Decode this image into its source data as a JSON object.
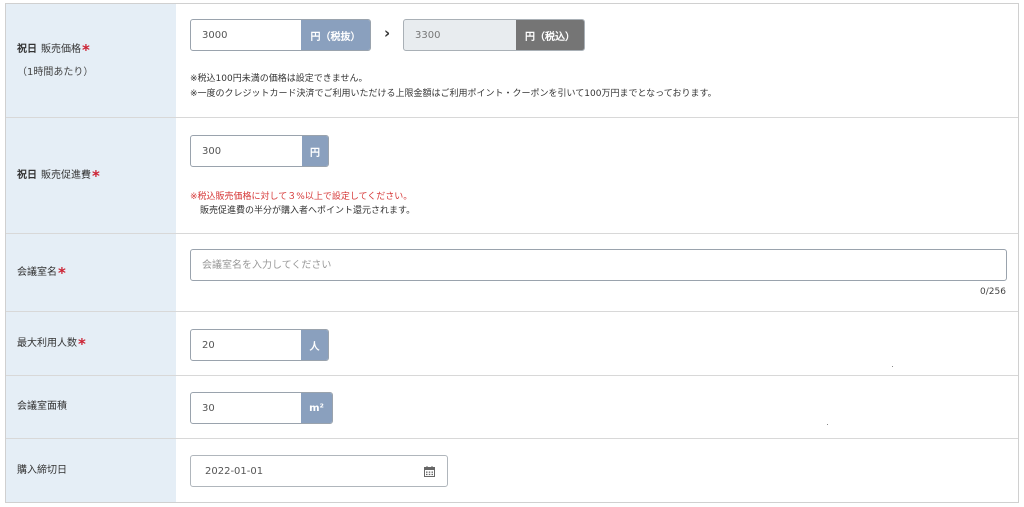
{
  "rows": {
    "holiday_price": {
      "tag": "祝日",
      "label": "販売価格",
      "required_mark": "*",
      "sub": "（1時間あたり）",
      "price_input_value": "3000",
      "price_unit": "円（税抜）",
      "arrow": "›",
      "tax_input_value": "3300",
      "tax_unit": "円（税込）",
      "notes": [
        "※税込100円未満の価格は設定できません。",
        "※一度のクレジットカード決済でご利用いただける上限金額はご利用ポイント・クーポンを引いて100万円までとなっております。"
      ]
    },
    "holiday_promo": {
      "tag": "祝日",
      "label": "販売促進費",
      "required_mark": "*",
      "input_value": "300",
      "unit": "円",
      "note_red": "※税込販売価格に対して３%以上で設定してください。",
      "note": "販売促進費の半分が購入者へポイント還元されます。"
    },
    "room_name": {
      "label": "会議室名",
      "required_mark": "*",
      "placeholder": "会議室名を入力してください",
      "counter": "0/256"
    },
    "max_people": {
      "label": "最大利用人数",
      "required_mark": "*",
      "input_value": "20",
      "unit": "人"
    },
    "room_area": {
      "label": "会議室面積",
      "input_value": "30",
      "unit": "m²"
    },
    "deadline": {
      "label": "購入締切日",
      "input_value": "2022-01-01",
      "icon": "calendar-icon"
    }
  },
  "colors": {
    "label_bg": "#e5eef6",
    "addon_blue": "#8aa0be",
    "addon_gray": "#757575",
    "required": "#cc2233",
    "warning": "#d63838"
  }
}
